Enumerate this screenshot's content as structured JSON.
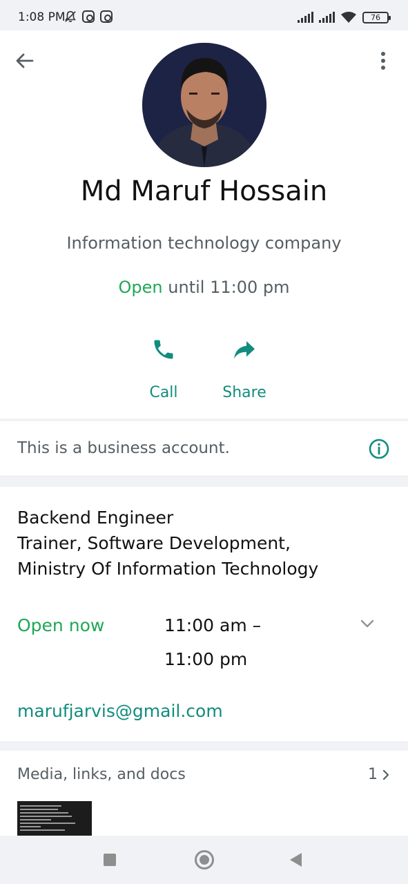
{
  "status_bar": {
    "time": "1:08 PM",
    "battery": "76"
  },
  "profile": {
    "name": "Md Maruf Hossain",
    "category": "Information technology company",
    "open_label": "Open",
    "hours_text": "until 11:00 pm"
  },
  "actions": {
    "call_label": "Call",
    "share_label": "Share"
  },
  "business_notice": "This is a business account.",
  "about": {
    "lines": [
      "Backend Engineer",
      "Trainer, Software Development,",
      "Ministry Of Information Technology"
    ],
    "open_now": "Open now",
    "hours_line1": "11:00 am –",
    "hours_line2": "11:00 pm",
    "email": "marufjarvis@gmail.com"
  },
  "media": {
    "title": "Media, links, and docs",
    "count": "1"
  },
  "colors": {
    "accent": "#128c7e",
    "open_green": "#1fa855",
    "muted": "#555e63"
  }
}
